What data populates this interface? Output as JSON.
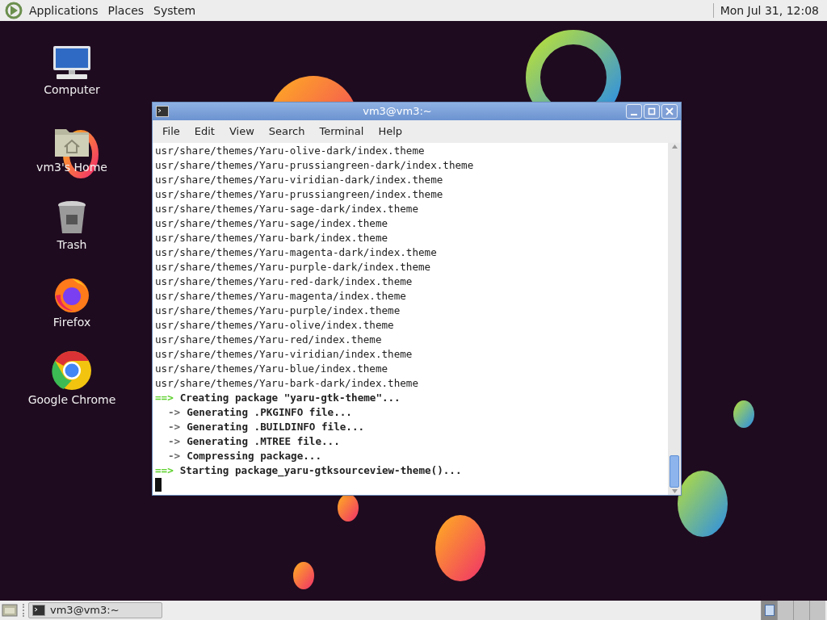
{
  "top_panel": {
    "menus": [
      "Applications",
      "Places",
      "System"
    ],
    "clock": "Mon Jul 31, 12:08"
  },
  "desktop_icons": [
    {
      "kind": "computer",
      "label": "Computer"
    },
    {
      "kind": "home",
      "label": "vm3's Home"
    },
    {
      "kind": "trash",
      "label": "Trash"
    },
    {
      "kind": "firefox",
      "label": "Firefox"
    },
    {
      "kind": "chrome",
      "label": "Google Chrome"
    }
  ],
  "terminal": {
    "title": "vm3@vm3:~",
    "menu": [
      "File",
      "Edit",
      "View",
      "Search",
      "Terminal",
      "Help"
    ],
    "lines": [
      {
        "kind": "plain",
        "text": "usr/share/themes/Yaru-olive-dark/index.theme"
      },
      {
        "kind": "plain",
        "text": "usr/share/themes/Yaru-prussiangreen-dark/index.theme"
      },
      {
        "kind": "plain",
        "text": "usr/share/themes/Yaru-viridian-dark/index.theme"
      },
      {
        "kind": "plain",
        "text": "usr/share/themes/Yaru-prussiangreen/index.theme"
      },
      {
        "kind": "plain",
        "text": "usr/share/themes/Yaru-sage-dark/index.theme"
      },
      {
        "kind": "plain",
        "text": "usr/share/themes/Yaru-sage/index.theme"
      },
      {
        "kind": "plain",
        "text": "usr/share/themes/Yaru-bark/index.theme"
      },
      {
        "kind": "plain",
        "text": "usr/share/themes/Yaru-magenta-dark/index.theme"
      },
      {
        "kind": "plain",
        "text": "usr/share/themes/Yaru-purple-dark/index.theme"
      },
      {
        "kind": "plain",
        "text": "usr/share/themes/Yaru-red-dark/index.theme"
      },
      {
        "kind": "plain",
        "text": "usr/share/themes/Yaru-magenta/index.theme"
      },
      {
        "kind": "plain",
        "text": "usr/share/themes/Yaru-purple/index.theme"
      },
      {
        "kind": "plain",
        "text": "usr/share/themes/Yaru-olive/index.theme"
      },
      {
        "kind": "plain",
        "text": "usr/share/themes/Yaru-red/index.theme"
      },
      {
        "kind": "plain",
        "text": "usr/share/themes/Yaru-viridian/index.theme"
      },
      {
        "kind": "plain",
        "text": "usr/share/themes/Yaru-blue/index.theme"
      },
      {
        "kind": "plain",
        "text": "usr/share/themes/Yaru-bark-dark/index.theme"
      },
      {
        "kind": "section",
        "marker": "==>",
        "text": "Creating package \"yaru-gtk-theme\"..."
      },
      {
        "kind": "step",
        "marker": "->",
        "text": "Generating .PKGINFO file..."
      },
      {
        "kind": "step",
        "marker": "->",
        "text": "Generating .BUILDINFO file..."
      },
      {
        "kind": "step",
        "marker": "->",
        "text": "Generating .MTREE file..."
      },
      {
        "kind": "step",
        "marker": "->",
        "text": "Compressing package..."
      },
      {
        "kind": "section",
        "marker": "==>",
        "text": "Starting package_yaru-gtksourceview-theme()..."
      }
    ]
  },
  "bottom_panel": {
    "tasks": [
      {
        "label": "vm3@vm3:~",
        "selected": false
      }
    ],
    "workspaces": [
      {
        "selected": true
      },
      {
        "selected": false
      },
      {
        "selected": false
      },
      {
        "selected": false
      }
    ]
  }
}
